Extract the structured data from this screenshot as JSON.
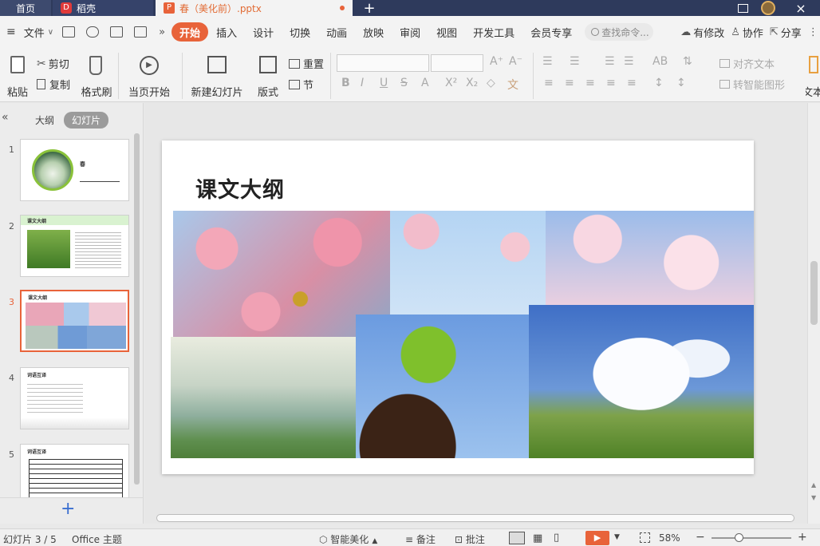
{
  "titlebar": {
    "tabs": [
      {
        "label": "首页"
      },
      {
        "label": "稻壳"
      },
      {
        "label": "春（美化前）.pptx"
      }
    ],
    "new_tab": "+",
    "window": {
      "close": "×"
    }
  },
  "menu": {
    "file": "文件",
    "file_arrow": "∨",
    "more": "»",
    "tabs": [
      "开始",
      "插入",
      "设计",
      "切换",
      "动画",
      "放映",
      "审阅",
      "视图",
      "开发工具",
      "会员专享"
    ],
    "search_placeholder": "查找命令...",
    "right": {
      "edit": "有修改",
      "collab": "协作",
      "share": "分享"
    }
  },
  "ribbon": {
    "paste": "粘贴",
    "cut": "剪切",
    "copy": "复制",
    "format_painter": "格式刷",
    "from_current": "当页开始",
    "new_slide": "新建幻灯片",
    "layout": "版式",
    "reset": "重置",
    "section": "节",
    "align_text": "对齐文本",
    "smart_shape": "转智能图形",
    "text": "文本"
  },
  "left_panel": {
    "collapse": "«",
    "tabs": {
      "outline": "大纲",
      "slides": "幻灯片"
    },
    "slides": [
      {
        "num": "1",
        "title": "春"
      },
      {
        "num": "2",
        "title": "课文大纲"
      },
      {
        "num": "3",
        "title": "课文大纲"
      },
      {
        "num": "4",
        "title": "词语互译"
      },
      {
        "num": "5",
        "title": "词语互译"
      }
    ],
    "add": "+",
    "selected_index": 2
  },
  "slide": {
    "title": "课文大纲"
  },
  "statusbar": {
    "slide_index": "幻灯片 3 / 5",
    "theme": "Office 主题",
    "beautify": "智能美化",
    "notes": "备注",
    "comment": "批注",
    "zoom": "58%",
    "zoom_level": 0.58
  },
  "colors": {
    "accent": "#e8633a",
    "titlebar": "#2e3a5c",
    "ribbon": "#f3f3f3"
  }
}
